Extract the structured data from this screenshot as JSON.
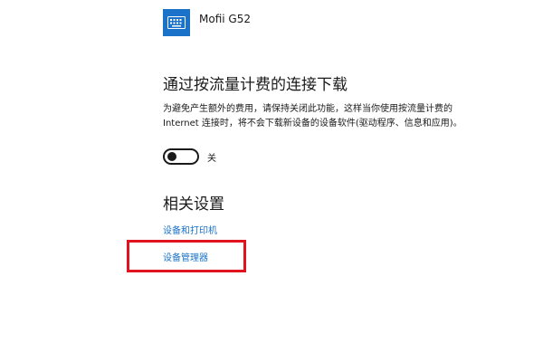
{
  "device": {
    "name": "Mofii G52",
    "icon": "keyboard-icon",
    "icon_color": "#1a73c8"
  },
  "metered": {
    "title": "通过按流量计费的连接下载",
    "description": "为避免产生额外的费用，请保持关闭此功能，这样当你使用按流量计费的 Internet 连接时，将不会下载新设备的设备软件(驱动程序、信息和应用)。",
    "toggle_state": "关"
  },
  "related": {
    "title": "相关设置",
    "links": [
      "设备和打印机",
      "设备管理器"
    ],
    "link_color": "#1a73c8"
  },
  "annotation": {
    "highlight_color": "#e0131e"
  }
}
